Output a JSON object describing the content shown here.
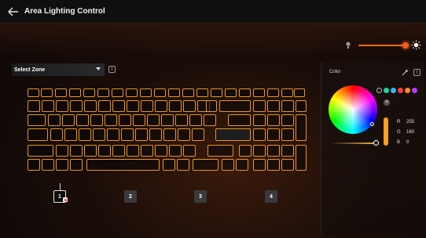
{
  "window": {
    "title": "Area Lighting Control"
  },
  "icons": {
    "back": "back-arrow-icon",
    "bulb": "bulb-icon",
    "sun": "sun-icon",
    "info": "info-icon",
    "dropper": "eyedropper-icon",
    "add": "add-icon"
  },
  "brightness": {
    "level": 0.95,
    "track_color": "#ff6a1a"
  },
  "zone_select": {
    "label": "Select Zone"
  },
  "zones": [
    {
      "label": "1",
      "active": true
    },
    {
      "label": "2",
      "active": false
    },
    {
      "label": "3",
      "active": false
    },
    {
      "label": "4",
      "active": false
    }
  ],
  "keyboard": {
    "key_outline_color": "#e8961e"
  },
  "color_panel": {
    "label": "Color",
    "swatches": [
      "#1ed39a",
      "#2fb8ff",
      "#ff3a3a",
      "#ff8a1e",
      "#b53cff"
    ],
    "rgb": {
      "r_label": "R",
      "r": "255",
      "g_label": "G",
      "g": "160",
      "b_label": "B",
      "b": "0"
    },
    "current_color": "#ffa01e"
  }
}
